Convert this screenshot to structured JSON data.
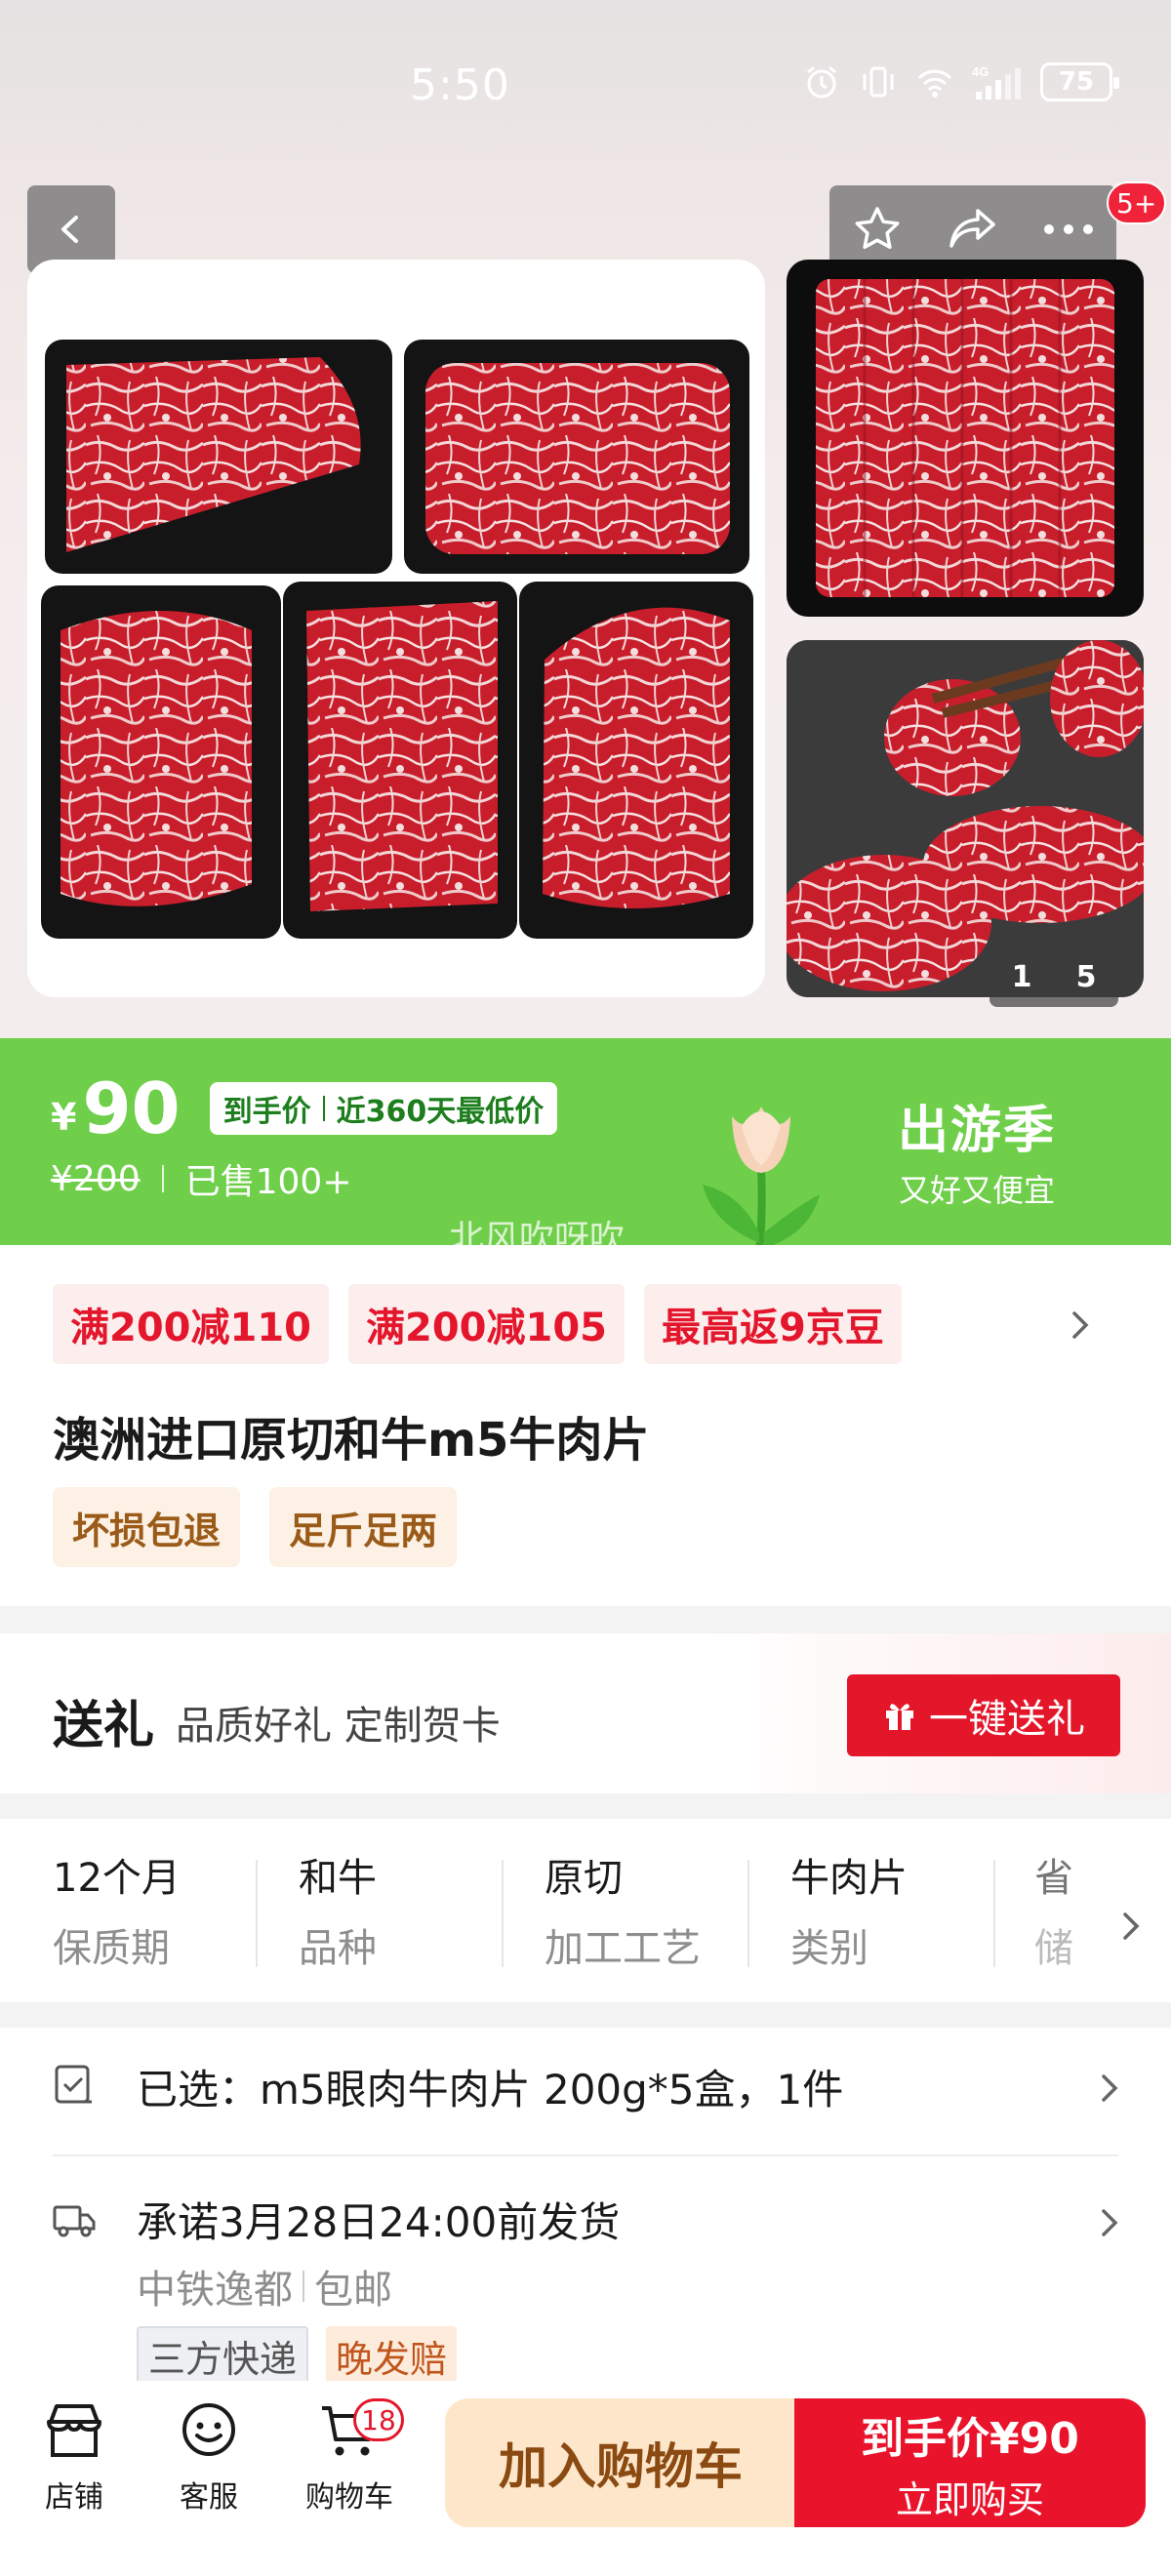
{
  "status_bar": {
    "time": "5:50",
    "signal": "4G",
    "battery": "75"
  },
  "gallery": {
    "current": "1",
    "total": "5",
    "notification_count": "5+"
  },
  "price": {
    "currency": "¥",
    "amount": "90",
    "tag_label": "到手价",
    "tag_note": "近360天最低价",
    "original": "¥200",
    "sold": "已售100+",
    "season_title": "出游季",
    "season_sub": "又好又便宜",
    "watermark": "北风吹呀吹"
  },
  "coupons": [
    "满200减110",
    "满200减105",
    "最高返9京豆"
  ],
  "product": {
    "title": "澳洲进口原切和牛m5牛肉片",
    "badges": [
      "坏损包退",
      "足斤足两"
    ]
  },
  "gift": {
    "title": "送礼",
    "desc": "品质好礼 定制贺卡",
    "button": "一键送礼"
  },
  "specs": [
    {
      "value": "12个月",
      "label": "保质期"
    },
    {
      "value": "和牛",
      "label": "品种"
    },
    {
      "value": "原切",
      "label": "加工工艺"
    },
    {
      "value": "牛肉片",
      "label": "类别"
    },
    {
      "value": "省",
      "label": "储"
    }
  ],
  "selection": {
    "text": "已选：m5眼肉牛肉片 200g*5盒，1件"
  },
  "shipping": {
    "promise": "承诺3月28日24:00前发货",
    "origin": "中铁逸都",
    "free": "包邮",
    "tags": [
      "三方快递",
      "晚发赔"
    ]
  },
  "bottom_bar": {
    "shop": "店铺",
    "service": "客服",
    "cart": "购物车",
    "cart_count": "18",
    "add_to_cart": "加入购物车",
    "buy_price_line": "到手价¥90",
    "buy_action": "立即购买"
  },
  "colors": {
    "accent_red": "#e9142b",
    "banner_green": "#6fcf4a",
    "badge_brown": "#9a5a18"
  }
}
